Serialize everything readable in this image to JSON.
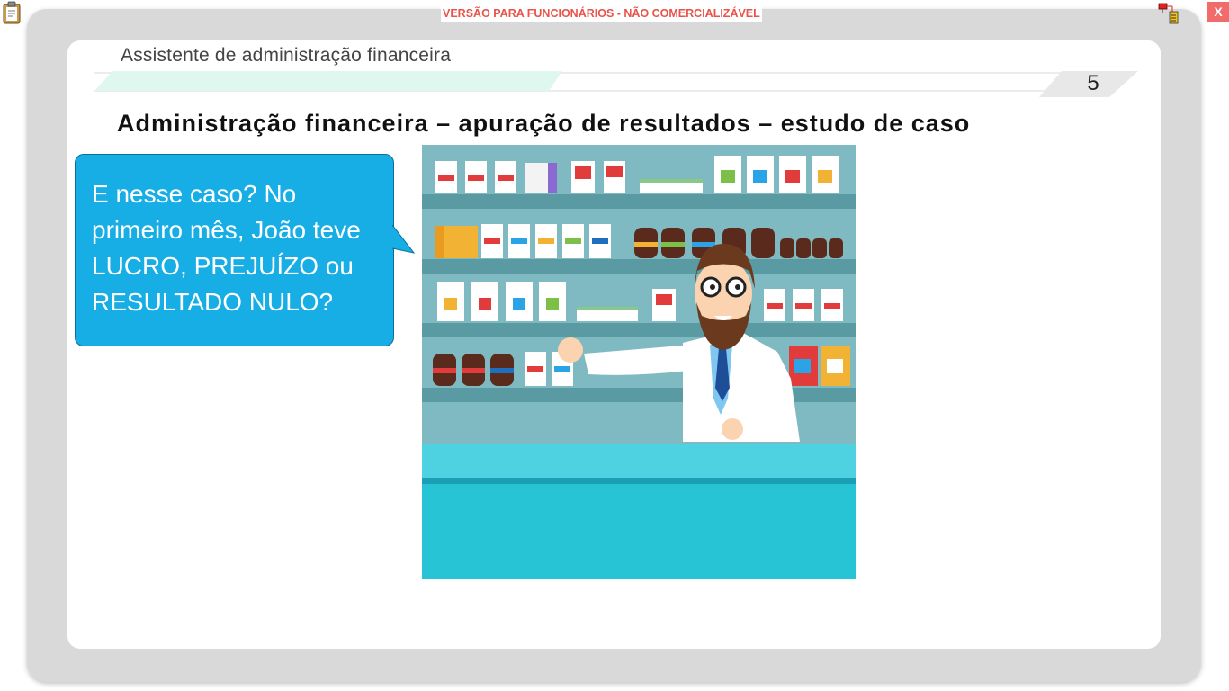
{
  "watermark": "VERSÃO PARA FUNCIONÁRIOS - NÃO COMERCIALIZÁVEL",
  "window": {
    "close_label": "X"
  },
  "header": {
    "course_title": "Assistente de administração financeira",
    "page_number": "5"
  },
  "slide": {
    "title": "Administração financeira – apuração de resultados – estudo de caso",
    "bubble_lines": [
      "E nesse caso? No",
      "primeiro mês, João teve",
      "LUCRO, PREJUÍZO ou",
      "RESULTADO NULO?"
    ]
  },
  "colors": {
    "bubble": "#17aee6",
    "watermark": "#e8534a",
    "shelf_bg": "#7fb9c2",
    "counter": "#27c4d6",
    "close_button": "#f26b6b"
  },
  "icons": [
    "clipboard-icon",
    "network-document-icon",
    "close-icon"
  ]
}
